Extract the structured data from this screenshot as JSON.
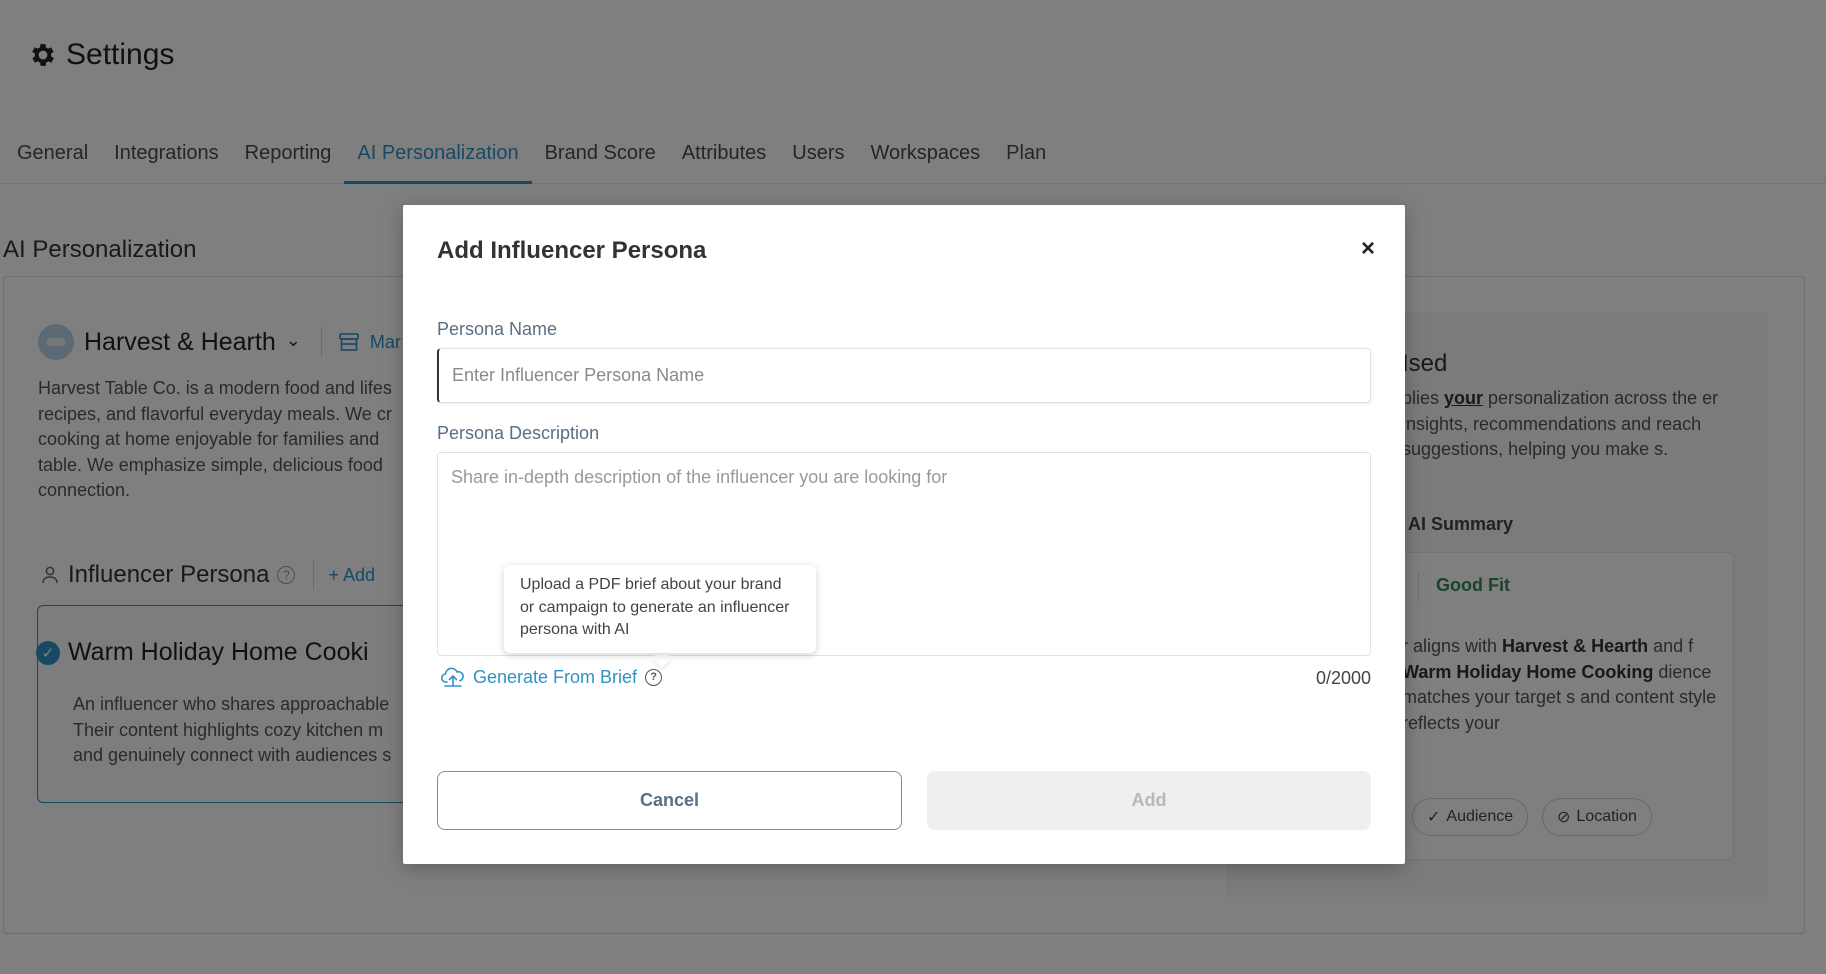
{
  "page": {
    "title": "Settings",
    "tabs": [
      "General",
      "Integrations",
      "Reporting",
      "AI Personalization",
      "Brand Score",
      "Attributes",
      "Users",
      "Workspaces",
      "Plan"
    ],
    "active_tab": "AI Personalization",
    "section_title": "AI Personalization"
  },
  "brand": {
    "name": "Harvest & Hearth",
    "manage_link": "Mar",
    "description": "Harvest Table Co. is a modern food and lifes recipes, and flavorful everyday meals. We cr cooking at home enjoyable for families and table. We emphasize simple, delicious food connection."
  },
  "persona_section": {
    "heading": "Influencer Persona",
    "add_link": "Add",
    "card_title": "Warm Holiday Home Cooki",
    "card_desc_lines": [
      "An influencer who shares approachable",
      "Their content highlights cozy kitchen m",
      "and genuinely connect with audiences s"
    ]
  },
  "right_panel": {
    "title": "Ised",
    "desc_pre": "plies ",
    "desc_bold": "your",
    "desc_post": " personalization across the er insights, recommendations and reach suggestions, helping you make s.",
    "summary_label": "AI Summary",
    "fit_label": "Good Fit",
    "card_text_1": "r aligns with ",
    "card_bold_1": "Harvest & Hearth",
    "card_text_2": " and f ",
    "card_bold_2": "Warm Holiday Home Cooking",
    "card_text_3": " dience matches your target s and content style reflects your",
    "chip_audience": "Audience",
    "chip_location": "Location"
  },
  "modal": {
    "title": "Add Influencer Persona",
    "close_glyph": "×",
    "name_label": "Persona Name",
    "name_placeholder": "Enter Influencer Persona Name",
    "desc_label": "Persona Description",
    "desc_placeholder": "Share in-depth description of the influencer you are looking for",
    "tooltip": "Upload a PDF brief about your brand or campaign to generate an influencer persona with AI",
    "generate_label": "Generate From Brief",
    "char_count": "0/2000",
    "cancel_label": "Cancel",
    "add_label": "Add"
  },
  "colors": {
    "accent": "#2e93c6",
    "good_fit": "#2e8b57",
    "overlay": "rgba(0,0,0,0.5)"
  },
  "icons": [
    "gear-icon",
    "chevron-down-icon",
    "store-icon",
    "person-icon",
    "help-icon",
    "plus-icon",
    "check-circle-icon",
    "close-icon",
    "upload-cloud-icon",
    "check-icon",
    "block-icon"
  ]
}
